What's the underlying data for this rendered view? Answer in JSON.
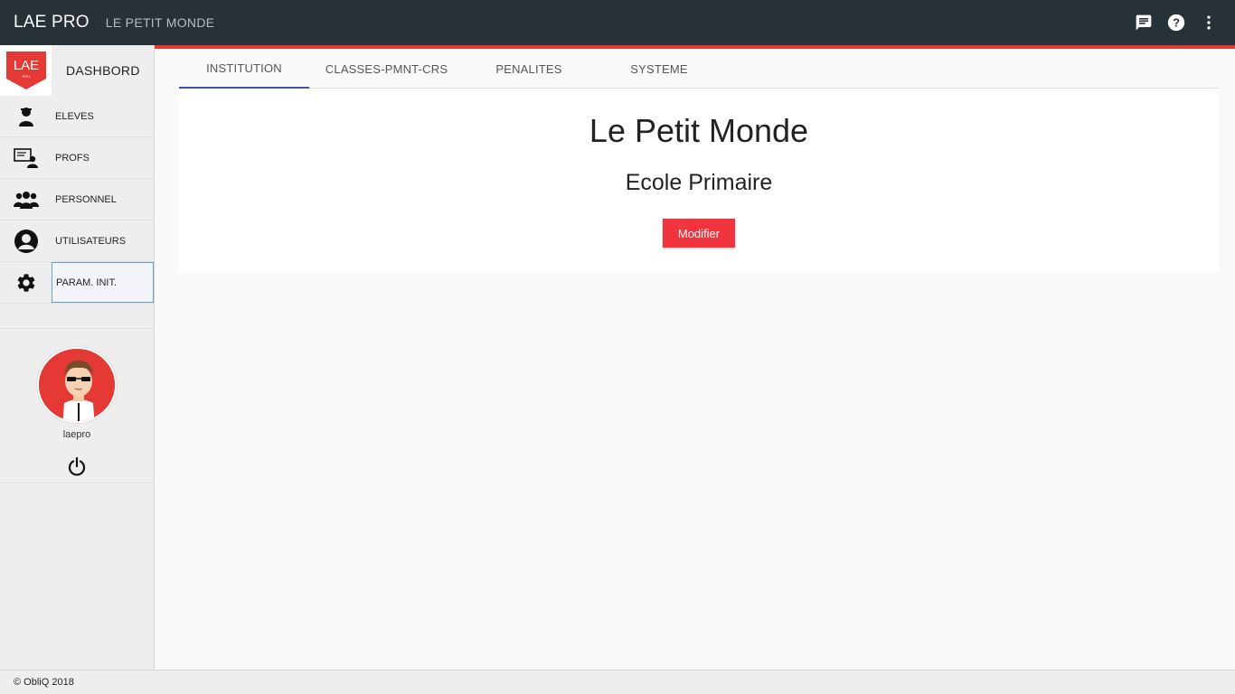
{
  "header": {
    "title": "LAE PRO",
    "subtitle": "LE PETIT MONDE",
    "icons": [
      "message-icon",
      "help-icon",
      "more-vert-icon"
    ]
  },
  "sidebar": {
    "logo": {
      "text": "LAE",
      "small": "PRO"
    },
    "dashboard_label": "DASHBORD",
    "items": [
      {
        "label": "ELEVES",
        "icon": "student-icon"
      },
      {
        "label": "PROFS",
        "icon": "teacher-icon"
      },
      {
        "label": "PERSONNEL",
        "icon": "group-icon"
      },
      {
        "label": "UTILISATEURS",
        "icon": "user-icon"
      },
      {
        "label": "PARAM. INIT.",
        "icon": "gear-icon",
        "active": true
      }
    ],
    "profile": {
      "username": "laepro"
    }
  },
  "tabs": [
    {
      "label": "INSTITUTION",
      "active": true
    },
    {
      "label": "CLASSES-PMNT-CRS"
    },
    {
      "label": "PENALITES"
    },
    {
      "label": "SYSTEME"
    }
  ],
  "main": {
    "school_name": "Le Petit Monde",
    "school_type": "Ecole Primaire",
    "modify_label": "Modifier"
  },
  "footer": {
    "text": "© ObliQ 2018"
  },
  "colors": {
    "topbar": "#263238",
    "accent_red": "#e53935",
    "button_red": "#f0353f",
    "tab_indicator": "#3f51b5",
    "active_outline": "#64a0d8"
  }
}
